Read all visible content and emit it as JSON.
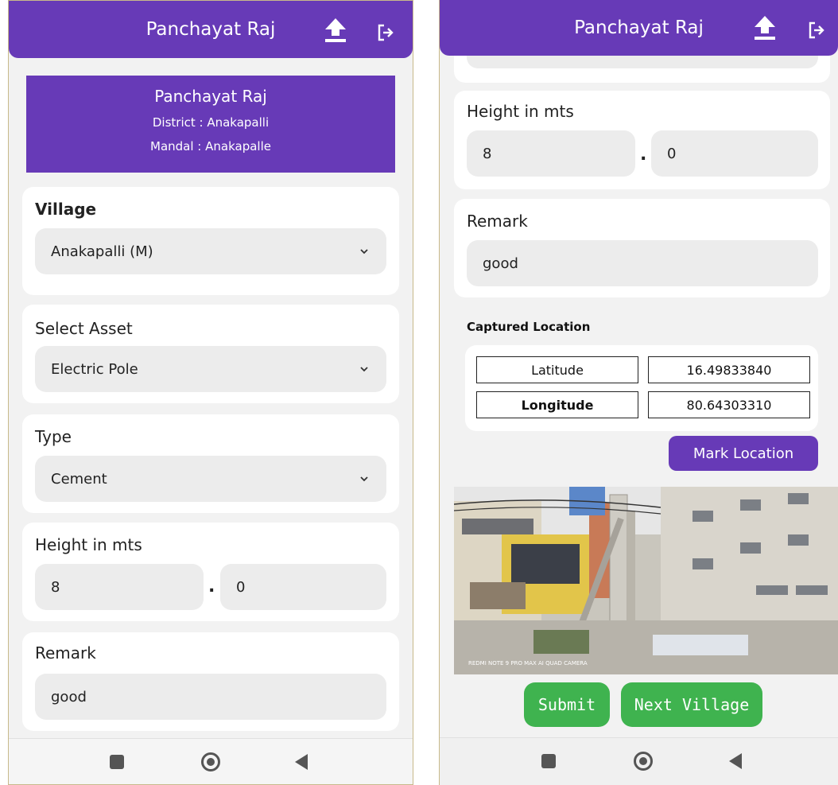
{
  "colors": {
    "primary": "#673ab7",
    "green": "#3fb34f",
    "field": "#ececec"
  },
  "icons": {
    "upload": "upload-icon",
    "logout": "logout-icon",
    "chevron": "chevron-down-icon"
  },
  "app": {
    "title": "Panchayat Raj"
  },
  "left": {
    "banner": {
      "title": "Panchayat Raj",
      "district": "District : Anakapalli",
      "mandal": "Mandal : Anakapalle"
    },
    "village": {
      "label": "Village",
      "value": "Anakapalli (M)"
    },
    "asset": {
      "label": "Select Asset",
      "value": "Electric Pole"
    },
    "type": {
      "label": "Type",
      "value": "Cement"
    },
    "height": {
      "label": "Height in mts",
      "whole": "8",
      "separator": ".",
      "fraction": "0"
    },
    "remark": {
      "label": "Remark",
      "value": "good"
    }
  },
  "right": {
    "height": {
      "label": "Height in mts",
      "whole": "8",
      "separator": ".",
      "fraction": "0"
    },
    "remark": {
      "label": "Remark",
      "value": "good"
    },
    "location": {
      "title": "Captured Location",
      "latitude_label": "Latitude",
      "latitude_value": "16.49833840",
      "longitude_label": "Longitude",
      "longitude_value": "80.64303310",
      "mark_button": "Mark Location"
    },
    "photo_caption": "REDMI NOTE 9 PRO MAX AI QUAD CAMERA",
    "submit_label": "Submit",
    "next_village_label": "Next Village"
  }
}
